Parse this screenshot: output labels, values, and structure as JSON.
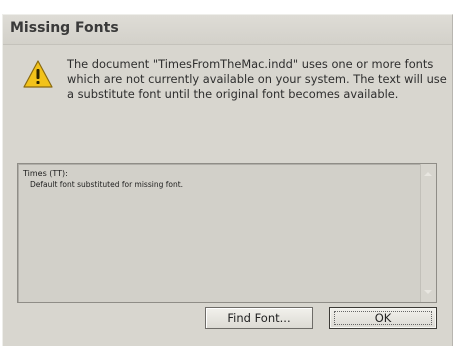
{
  "dialog": {
    "title": "Missing Fonts",
    "message": "The document \"TimesFromTheMac.indd\" uses one or more fonts which are not currently available on your system. The text will use a substitute font until the original font becomes available.",
    "icon": "warning-icon"
  },
  "missing_fonts": [
    {
      "name": "Times (TT):",
      "description": "Default font substituted for missing font."
    }
  ],
  "buttons": {
    "find_font": "Find Font...",
    "ok": "OK"
  },
  "colors": {
    "dialog_bg": "#d8d6cf",
    "warning_yellow": "#f2c21a"
  }
}
